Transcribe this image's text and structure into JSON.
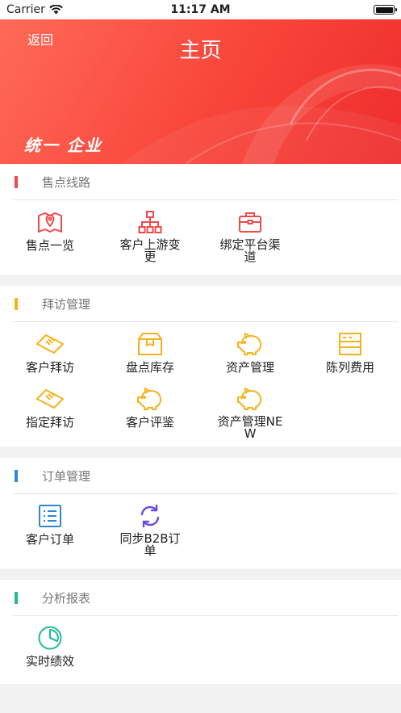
{
  "status": {
    "carrier": "Carrier",
    "time": "11:17 AM"
  },
  "header": {
    "back_label": "返回",
    "title": "主页",
    "brand": "统一 企业"
  },
  "colors": {
    "red": "#ee4a4a",
    "orange": "#f5b21b",
    "blue": "#2f86d6",
    "green": "#21b89c",
    "purple": "#6c4be0"
  },
  "sections": [
    {
      "title": "售点线路",
      "items": [
        {
          "label": "售点一览",
          "icon": "map-pin-icon"
        },
        {
          "label": "客户上游变更",
          "icon": "org-chart-icon"
        },
        {
          "label": "绑定平台渠道",
          "icon": "briefcase-icon"
        }
      ]
    },
    {
      "title": "拜访管理",
      "items": [
        {
          "label": "客户拜访",
          "icon": "handshake-icon"
        },
        {
          "label": "盘点库存",
          "icon": "box-icon"
        },
        {
          "label": "资产管理",
          "icon": "piggy-bank-icon"
        },
        {
          "label": "陈列费用",
          "icon": "shelf-icon"
        },
        {
          "label": "指定拜访",
          "icon": "handshake-icon"
        },
        {
          "label": "客户评鉴",
          "icon": "piggy-bank-icon"
        },
        {
          "label": "资产管理NEW",
          "icon": "piggy-bank-icon"
        }
      ]
    },
    {
      "title": "订单管理",
      "items": [
        {
          "label": "客户订单",
          "icon": "list-icon"
        },
        {
          "label": "同步B2B订单",
          "icon": "sync-icon"
        }
      ]
    },
    {
      "title": "分析报表",
      "items": [
        {
          "label": "实时绩效",
          "icon": "pie-chart-icon"
        }
      ]
    }
  ]
}
